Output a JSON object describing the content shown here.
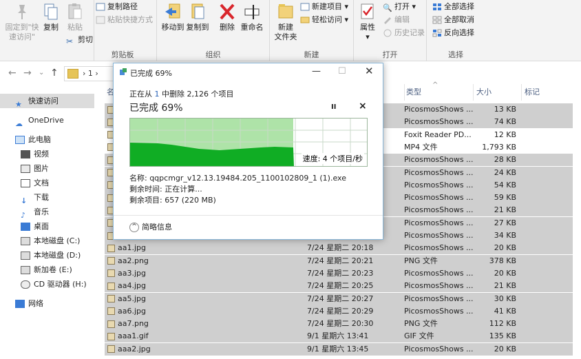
{
  "ribbon": {
    "pin_label1": "固定到\"快",
    "pin_label2": "速访问\"",
    "copy": "复制",
    "paste": "粘贴",
    "copy_path": "复制路径",
    "paste_shortcut": "粘贴快捷方式",
    "cut": "剪切",
    "clipboard_group": "剪贴板",
    "move_to": "移动到",
    "copy_to": "复制到",
    "delete": "删除",
    "rename": "重命名",
    "organize_group": "组织",
    "new_folder1": "新建",
    "new_folder2": "文件夹",
    "new_item": "新建项目",
    "easy_access": "轻松访问",
    "new_group": "新建",
    "properties": "属性",
    "open": "打开",
    "edit": "编辑",
    "history": "历史记录",
    "open_group": "打开",
    "select_all": "全部选择",
    "select_none": "全部取消",
    "invert_select": "反向选择",
    "select_group": "选择"
  },
  "address": {
    "crumb": "1"
  },
  "sidebar": {
    "quick_access": "快速访问",
    "onedrive": "OneDrive",
    "this_pc": "此电脑",
    "videos": "视频",
    "pictures": "图片",
    "documents": "文档",
    "downloads": "下载",
    "music": "音乐",
    "desktop": "桌面",
    "drive_c": "本地磁盘 (C:)",
    "drive_d": "本地磁盘 (D:)",
    "drive_e": "新加卷 (E:)",
    "drive_h": "CD 驱动器 (H:)",
    "network": "网络"
  },
  "columns": {
    "name": "名",
    "type": "类型",
    "size": "大小",
    "tag": "标记"
  },
  "files_top": [
    {
      "type": "PicosmosShows ...",
      "size": "13 KB"
    },
    {
      "type": "PicosmosShows ...",
      "size": "74 KB"
    },
    {
      "type": "Foxit Reader PD...",
      "size": "12 KB"
    },
    {
      "type": "MP4 文件",
      "size": "1,793 KB"
    },
    {
      "type": "PicosmosShows ...",
      "size": "28 KB"
    },
    {
      "type": "PicosmosShows ...",
      "size": "24 KB"
    },
    {
      "type": "PicosmosShows ...",
      "size": "54 KB"
    },
    {
      "type": "PicosmosShows ...",
      "size": "59 KB"
    },
    {
      "type": "PicosmosShows ...",
      "size": "21 KB"
    },
    {
      "type": "PicosmosShows ...",
      "size": "27 KB"
    },
    {
      "type": "PicosmosShows ...",
      "size": "34 KB"
    }
  ],
  "files": [
    {
      "name": "aa1.jpg",
      "date": "7/24 星期二 20:18",
      "type": "PicosmosShows ...",
      "size": "20 KB"
    },
    {
      "name": "aa2.png",
      "date": "7/24 星期二 20:21",
      "type": "PNG 文件",
      "size": "378 KB"
    },
    {
      "name": "aa3.jpg",
      "date": "7/24 星期二 20:23",
      "type": "PicosmosShows ...",
      "size": "20 KB"
    },
    {
      "name": "aa4.jpg",
      "date": "7/24 星期二 20:25",
      "type": "PicosmosShows ...",
      "size": "21 KB"
    },
    {
      "name": "aa5.jpg",
      "date": "7/24 星期二 20:27",
      "type": "PicosmosShows ...",
      "size": "30 KB"
    },
    {
      "name": "aa6.jpg",
      "date": "7/24 星期二 20:29",
      "type": "PicosmosShows ...",
      "size": "41 KB"
    },
    {
      "name": "aa7.png",
      "date": "7/24 星期二 20:30",
      "type": "PNG 文件",
      "size": "112 KB"
    },
    {
      "name": "aaa1.gif",
      "date": "9/1 星期六 13:41",
      "type": "GIF 文件",
      "size": "135 KB"
    },
    {
      "name": "aaa2.jpg",
      "date": "9/1 星期六 13:45",
      "type": "PicosmosShows ...",
      "size": "20 KB"
    }
  ],
  "dialog": {
    "title": "已完成 69%",
    "line1_pre": "正在从",
    "line1_num": "1",
    "line1_post": "中删除 2,126 个项目",
    "status": "已完成 69%",
    "progress": 0.69,
    "speed": "速度: 4 个项目/秒",
    "name_line": "名称: qqpcmgr_v12.13.19484.205_1100102809_1 (1).exe",
    "remaining_time": "剩余时间: 正在计算...",
    "remaining_items": "剩余项目: 657 (220 MB)",
    "details": "简略信息",
    "pause": "II",
    "close_x": "×"
  }
}
